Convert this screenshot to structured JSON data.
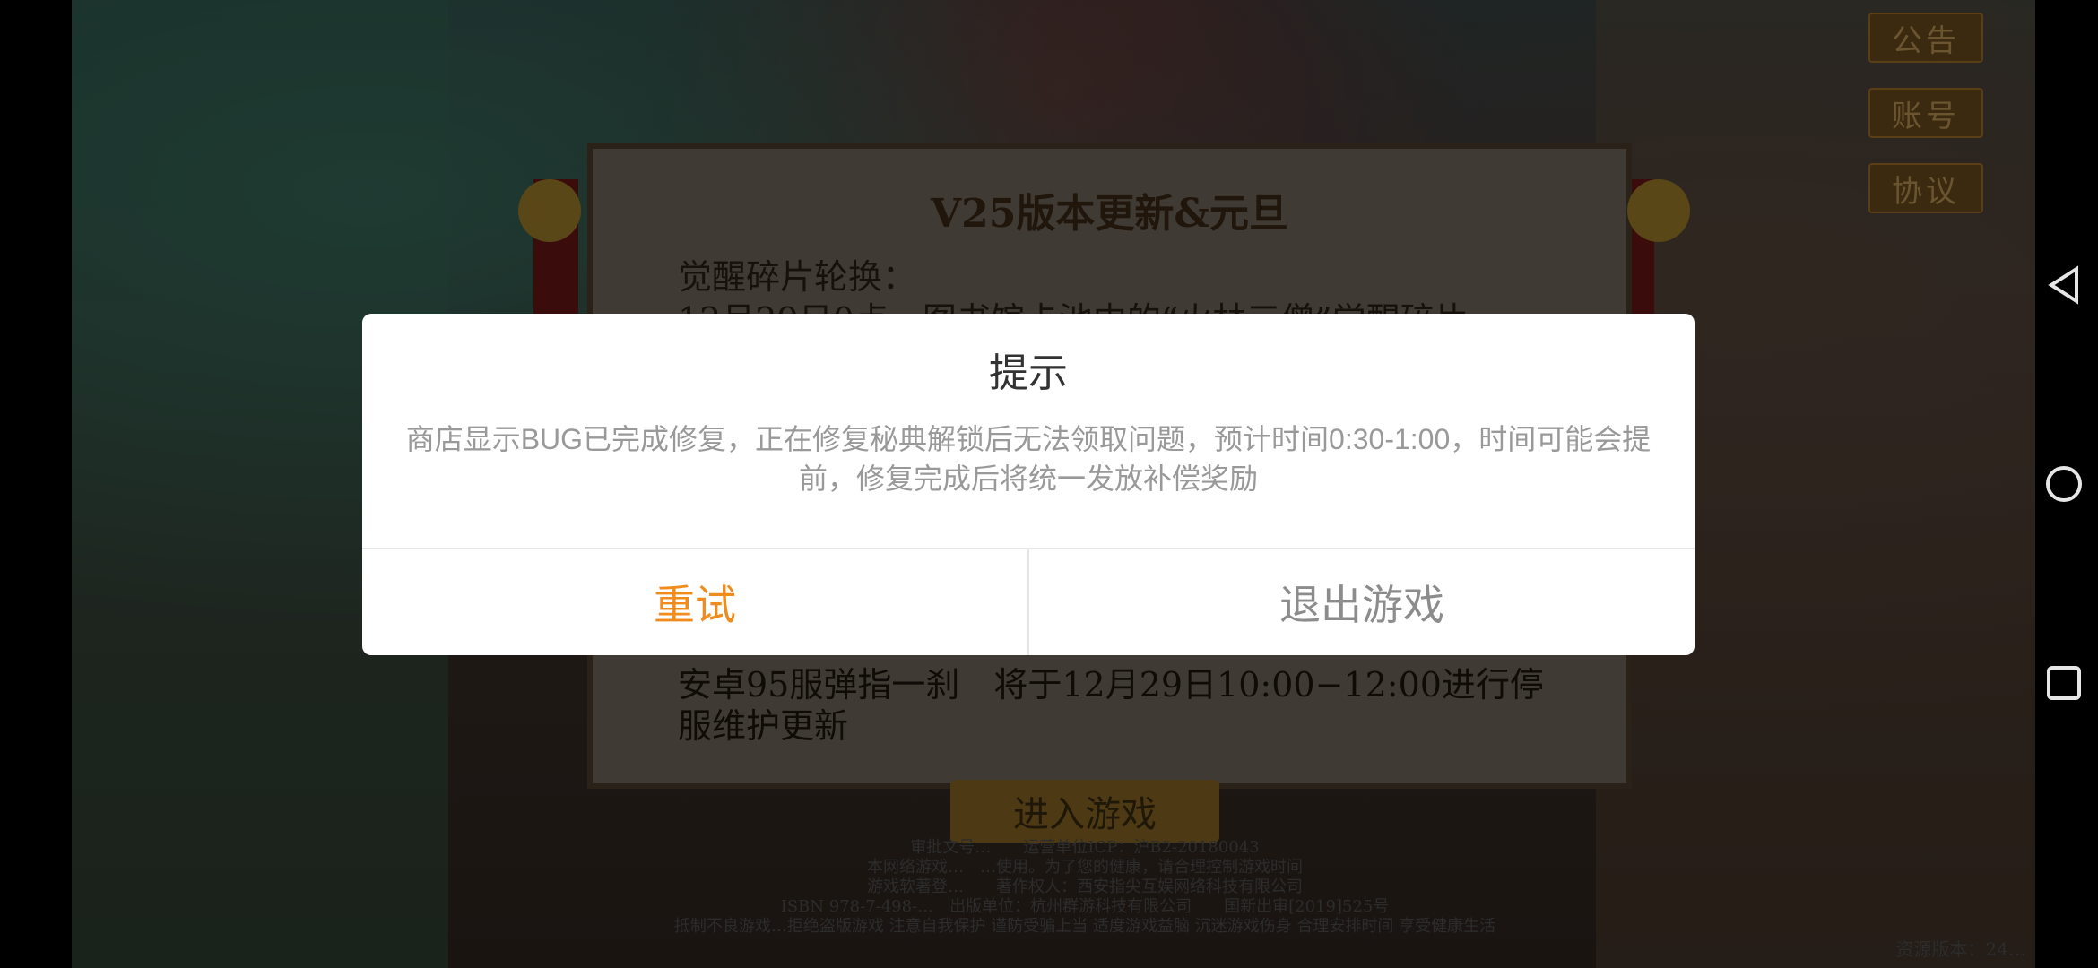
{
  "side_buttons": {
    "notice": "公告",
    "account": "账号",
    "agreement": "协议"
  },
  "notice_panel": {
    "title": "V25版本更新&元旦",
    "heading": "觉醒碎片轮换：",
    "partial_line": "12月29日0点，图书馆卡池中的“火林三僧”觉醒碎片",
    "maintenance_line": "安卓95服弹指一刹　将于12月29日10:00−12:00进行停服维护更新"
  },
  "enter_button": "进入游戏",
  "footer": {
    "line1": "审批文号…　　运营单位ICP：沪B2-20180043",
    "line2": "本网络游戏…　…使用。为了您的健康，请合理控制游戏时间",
    "line3": "游戏软著登…　　著作权人：西安指尖互娱网络科技有限公司",
    "line4": "ISBN 978-7-498-…　出版单位：杭州群游科技有限公司　　国新出审[2019]525号",
    "line5": "抵制不良游戏…拒绝盗版游戏 注意自我保护 谨防受骗上当 适度游戏益脑 沉迷游戏伤身 合理安排时间 享受健康生活"
  },
  "version": "资源版本：24…",
  "dialog": {
    "title": "提示",
    "message": "商店显示BUG已完成修复，正在修复秘典解锁后无法领取问题，预计时间0:30-1:00，时间可能会提前，修复完成后将统一发放补偿奖励",
    "retry_label": "重试",
    "exit_label": "退出游戏"
  },
  "colors": {
    "retry": "#f08c1e",
    "exit": "#8c8c8c",
    "overlay": "#000000"
  },
  "nav_icons": [
    "back-triangle-icon",
    "home-circle-icon",
    "recents-square-icon"
  ]
}
